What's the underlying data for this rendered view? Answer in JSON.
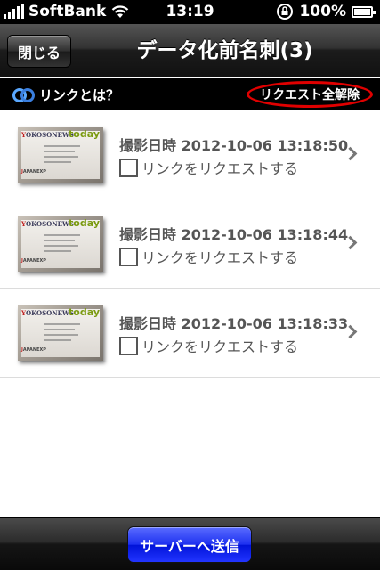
{
  "status_bar": {
    "carrier": "SoftBank",
    "time": "13:19",
    "battery": "100%",
    "battery_level": 1.0,
    "icons": [
      "signal-icon",
      "wifi-icon",
      "rotation-lock-icon",
      "battery-icon"
    ]
  },
  "nav": {
    "close_label": "閉じる",
    "title": "データ化前名刺(3)"
  },
  "link_bar": {
    "help_label": "リンクとは？",
    "clear_all_label": "リクエスト全解除"
  },
  "cards": [
    {
      "date_label": "撮影日時",
      "datetime": "2012-10-06 13:18:50",
      "request_label": "リンクをリクエストする",
      "checked": false
    },
    {
      "date_label": "撮影日時",
      "datetime": "2012-10-06 13:18:44",
      "request_label": "リンクをリクエストする",
      "checked": false
    },
    {
      "date_label": "撮影日時",
      "datetime": "2012-10-06 13:18:33",
      "request_label": "リンクをリクエストする",
      "checked": false
    }
  ],
  "thumbnail": {
    "logo_prefix": "Y",
    "logo_rest": "OKOSONEWS",
    "badge": "today",
    "company_prefix": "J",
    "company_rest": "APANEXP"
  },
  "bottom": {
    "send_label": "サーバーへ送信"
  },
  "colors": {
    "send_button": "#1d30f0",
    "clear_all_outline": "#e00000",
    "link_icon": "#5aa8ff"
  }
}
